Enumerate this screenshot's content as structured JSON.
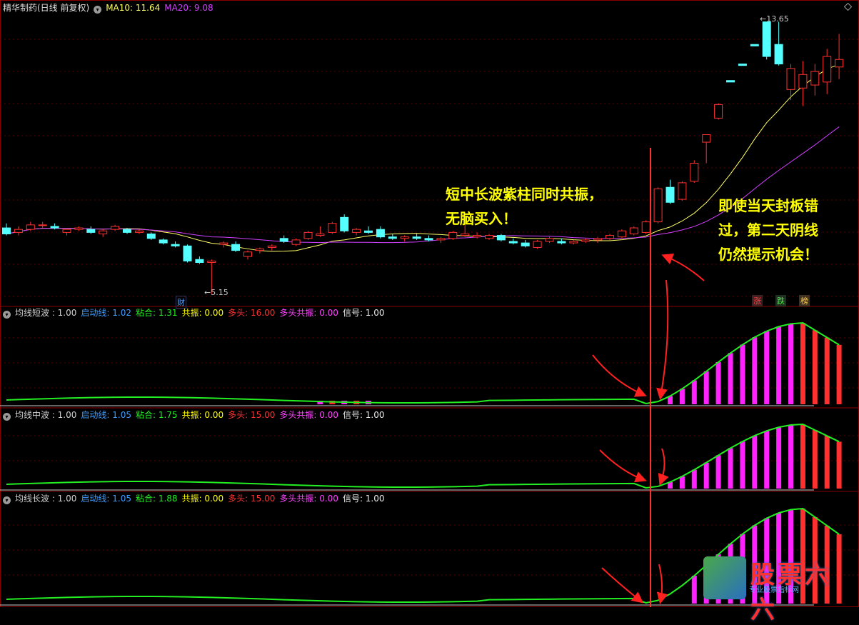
{
  "main": {
    "title": "精华制药(日线 前复权)",
    "ma10_label": "MA10: 11.64",
    "ma20_label": "MA20: 9.08",
    "high_label": "13.65",
    "low_label": "5.15",
    "cai_label": "财",
    "tags": [
      "涨",
      "跌",
      "榜"
    ]
  },
  "panels": [
    {
      "name": "均线短波",
      "value": ": 1.00",
      "fields": [
        {
          "label": "启动线",
          "value": "1.02",
          "color": "#3d9cff"
        },
        {
          "label": "粘合",
          "value": "1.31",
          "color": "#22ee22"
        },
        {
          "label": "共振",
          "value": "0.00",
          "color": "#ffff00"
        },
        {
          "label": "多头",
          "value": "16.00",
          "color": "#ff3030"
        },
        {
          "label": "多头共振",
          "value": "0.00",
          "color": "#ff44ff"
        },
        {
          "label": "信号",
          "value": "1.00",
          "color": "#e8e8e8"
        }
      ]
    },
    {
      "name": "均线中波",
      "value": ": 1.00",
      "fields": [
        {
          "label": "启动线",
          "value": "1.05",
          "color": "#3d9cff"
        },
        {
          "label": "粘合",
          "value": "1.75",
          "color": "#22ee22"
        },
        {
          "label": "共振",
          "value": "0.00",
          "color": "#ffff00"
        },
        {
          "label": "多头",
          "value": "15.00",
          "color": "#ff3030"
        },
        {
          "label": "多头共振",
          "value": "0.00",
          "color": "#ff44ff"
        },
        {
          "label": "信号",
          "value": "1.00",
          "color": "#e8e8e8"
        }
      ]
    },
    {
      "name": "均线长波",
      "value": ": 1.00",
      "fields": [
        {
          "label": "启动线",
          "value": "1.05",
          "color": "#3d9cff"
        },
        {
          "label": "粘合",
          "value": "1.88",
          "color": "#22ee22"
        },
        {
          "label": "共振",
          "value": "0.00",
          "color": "#ffff00"
        },
        {
          "label": "多头",
          "value": "15.00",
          "color": "#ff3030"
        },
        {
          "label": "多头共振",
          "value": "0.00",
          "color": "#ff44ff"
        },
        {
          "label": "信号",
          "value": "1.00",
          "color": "#e8e8e8"
        }
      ]
    }
  ],
  "annotations": {
    "left": [
      "短中长波紫柱同时共振，",
      "无脑买入！"
    ],
    "right": [
      "即使当天封板错",
      "过，第二天阴线",
      "仍然提示机会！"
    ]
  },
  "logo": {
    "title": "股票六六",
    "sub": "专业股票指标网"
  },
  "colors": {
    "bg": "#000000",
    "up": "#ff3030",
    "down": "#54ffff",
    "ma10": "#ffff66",
    "ma20": "#d040ff",
    "bull": "#ff22ff",
    "line": "#22ee22"
  },
  "chart_data": {
    "type": "candlestick",
    "price_range": [
      5.0,
      14.5
    ],
    "candles": [
      {
        "o": 7.35,
        "h": 7.5,
        "l": 7.1,
        "c": 7.15
      },
      {
        "o": 7.2,
        "h": 7.4,
        "l": 7.1,
        "c": 7.3
      },
      {
        "o": 7.3,
        "h": 7.55,
        "l": 7.25,
        "c": 7.45
      },
      {
        "o": 7.45,
        "h": 7.55,
        "l": 7.35,
        "c": 7.45
      },
      {
        "o": 7.4,
        "h": 7.5,
        "l": 7.3,
        "c": 7.35
      },
      {
        "o": 7.2,
        "h": 7.35,
        "l": 7.1,
        "c": 7.3
      },
      {
        "o": 7.3,
        "h": 7.4,
        "l": 7.25,
        "c": 7.35
      },
      {
        "o": 7.3,
        "h": 7.4,
        "l": 7.15,
        "c": 7.2
      },
      {
        "o": 7.15,
        "h": 7.3,
        "l": 7.05,
        "c": 7.25
      },
      {
        "o": 7.3,
        "h": 7.45,
        "l": 7.25,
        "c": 7.4
      },
      {
        "o": 7.3,
        "h": 7.35,
        "l": 7.15,
        "c": 7.2
      },
      {
        "o": 7.2,
        "h": 7.3,
        "l": 7.15,
        "c": 7.25
      },
      {
        "o": 7.15,
        "h": 7.2,
        "l": 6.95,
        "c": 7.0
      },
      {
        "o": 6.95,
        "h": 7.0,
        "l": 6.8,
        "c": 6.85
      },
      {
        "o": 6.8,
        "h": 6.9,
        "l": 6.7,
        "c": 6.75
      },
      {
        "o": 6.75,
        "h": 6.8,
        "l": 6.2,
        "c": 6.25
      },
      {
        "o": 6.3,
        "h": 6.4,
        "l": 6.15,
        "c": 6.2
      },
      {
        "o": 6.2,
        "h": 6.3,
        "l": 5.15,
        "c": 6.25
      },
      {
        "o": 6.8,
        "h": 6.9,
        "l": 6.7,
        "c": 6.85
      },
      {
        "o": 6.8,
        "h": 6.9,
        "l": 6.55,
        "c": 6.6
      },
      {
        "o": 6.4,
        "h": 6.6,
        "l": 6.3,
        "c": 6.55
      },
      {
        "o": 6.6,
        "h": 6.7,
        "l": 6.5,
        "c": 6.65
      },
      {
        "o": 6.7,
        "h": 6.8,
        "l": 6.6,
        "c": 6.75
      },
      {
        "o": 7.0,
        "h": 7.1,
        "l": 6.85,
        "c": 6.9
      },
      {
        "o": 6.8,
        "h": 7.0,
        "l": 6.75,
        "c": 6.95
      },
      {
        "o": 7.0,
        "h": 7.25,
        "l": 6.95,
        "c": 7.2
      },
      {
        "o": 7.1,
        "h": 7.4,
        "l": 7.05,
        "c": 7.15
      },
      {
        "o": 7.2,
        "h": 7.55,
        "l": 7.15,
        "c": 7.5
      },
      {
        "o": 7.7,
        "h": 7.8,
        "l": 7.2,
        "c": 7.25
      },
      {
        "o": 7.2,
        "h": 7.35,
        "l": 7.1,
        "c": 7.3
      },
      {
        "o": 7.25,
        "h": 7.4,
        "l": 7.15,
        "c": 7.2
      },
      {
        "o": 7.3,
        "h": 7.4,
        "l": 7.0,
        "c": 7.05
      },
      {
        "o": 7.05,
        "h": 7.15,
        "l": 6.95,
        "c": 7.0
      },
      {
        "o": 7.0,
        "h": 7.1,
        "l": 6.9,
        "c": 7.05
      },
      {
        "o": 7.05,
        "h": 7.15,
        "l": 6.95,
        "c": 7.0
      },
      {
        "o": 7.0,
        "h": 7.1,
        "l": 6.9,
        "c": 6.95
      },
      {
        "o": 6.95,
        "h": 7.05,
        "l": 6.85,
        "c": 7.0
      },
      {
        "o": 7.0,
        "h": 7.25,
        "l": 6.95,
        "c": 7.2
      },
      {
        "o": 7.1,
        "h": 7.5,
        "l": 7.05,
        "c": 7.15
      },
      {
        "o": 7.05,
        "h": 7.2,
        "l": 7.0,
        "c": 7.1
      },
      {
        "o": 7.0,
        "h": 7.15,
        "l": 6.95,
        "c": 7.1
      },
      {
        "o": 7.1,
        "h": 7.15,
        "l": 6.9,
        "c": 6.95
      },
      {
        "o": 6.9,
        "h": 7.0,
        "l": 6.8,
        "c": 6.85
      },
      {
        "o": 6.85,
        "h": 6.95,
        "l": 6.7,
        "c": 6.75
      },
      {
        "o": 6.7,
        "h": 6.95,
        "l": 6.65,
        "c": 6.9
      },
      {
        "o": 6.9,
        "h": 7.05,
        "l": 6.85,
        "c": 7.0
      },
      {
        "o": 6.9,
        "h": 7.0,
        "l": 6.8,
        "c": 6.85
      },
      {
        "o": 6.85,
        "h": 6.95,
        "l": 6.8,
        "c": 6.9
      },
      {
        "o": 6.9,
        "h": 7.0,
        "l": 6.85,
        "c": 6.95
      },
      {
        "o": 6.95,
        "h": 7.05,
        "l": 6.85,
        "c": 7.0
      },
      {
        "o": 7.0,
        "h": 7.15,
        "l": 6.95,
        "c": 7.1
      },
      {
        "o": 7.05,
        "h": 7.3,
        "l": 7.0,
        "c": 7.25
      },
      {
        "o": 7.15,
        "h": 7.4,
        "l": 7.1,
        "c": 7.35
      },
      {
        "o": 7.2,
        "h": 7.6,
        "l": 7.15,
        "c": 7.55
      },
      {
        "o": 7.55,
        "h": 8.7,
        "l": 7.5,
        "c": 8.65
      },
      {
        "o": 8.7,
        "h": 8.95,
        "l": 8.15,
        "c": 8.2
      },
      {
        "o": 8.3,
        "h": 8.9,
        "l": 8.25,
        "c": 8.85
      },
      {
        "o": 8.9,
        "h": 9.6,
        "l": 8.85,
        "c": 9.5
      },
      {
        "o": 10.2,
        "h": 10.45,
        "l": 9.5,
        "c": 10.45
      },
      {
        "o": 11.0,
        "h": 11.5,
        "l": 10.95,
        "c": 11.45
      },
      {
        "o": 12.25,
        "h": 12.25,
        "l": 12.2,
        "c": 12.2
      },
      {
        "o": 12.8,
        "h": 12.8,
        "l": 12.75,
        "c": 12.75
      },
      {
        "o": 13.45,
        "h": 13.45,
        "l": 13.4,
        "c": 13.4
      },
      {
        "o": 14.2,
        "h": 14.2,
        "l": 12.95,
        "c": 13.05
      },
      {
        "o": 13.45,
        "h": 14.2,
        "l": 12.75,
        "c": 12.8
      },
      {
        "o": 11.95,
        "h": 12.8,
        "l": 11.6,
        "c": 12.65
      },
      {
        "o": 12.0,
        "h": 12.9,
        "l": 11.4,
        "c": 12.45
      },
      {
        "o": 12.1,
        "h": 12.8,
        "l": 11.75,
        "c": 12.55
      },
      {
        "o": 12.2,
        "h": 13.3,
        "l": 11.8,
        "c": 13.05
      },
      {
        "o": 12.7,
        "h": 13.8,
        "l": 12.3,
        "c": 12.95
      }
    ]
  }
}
